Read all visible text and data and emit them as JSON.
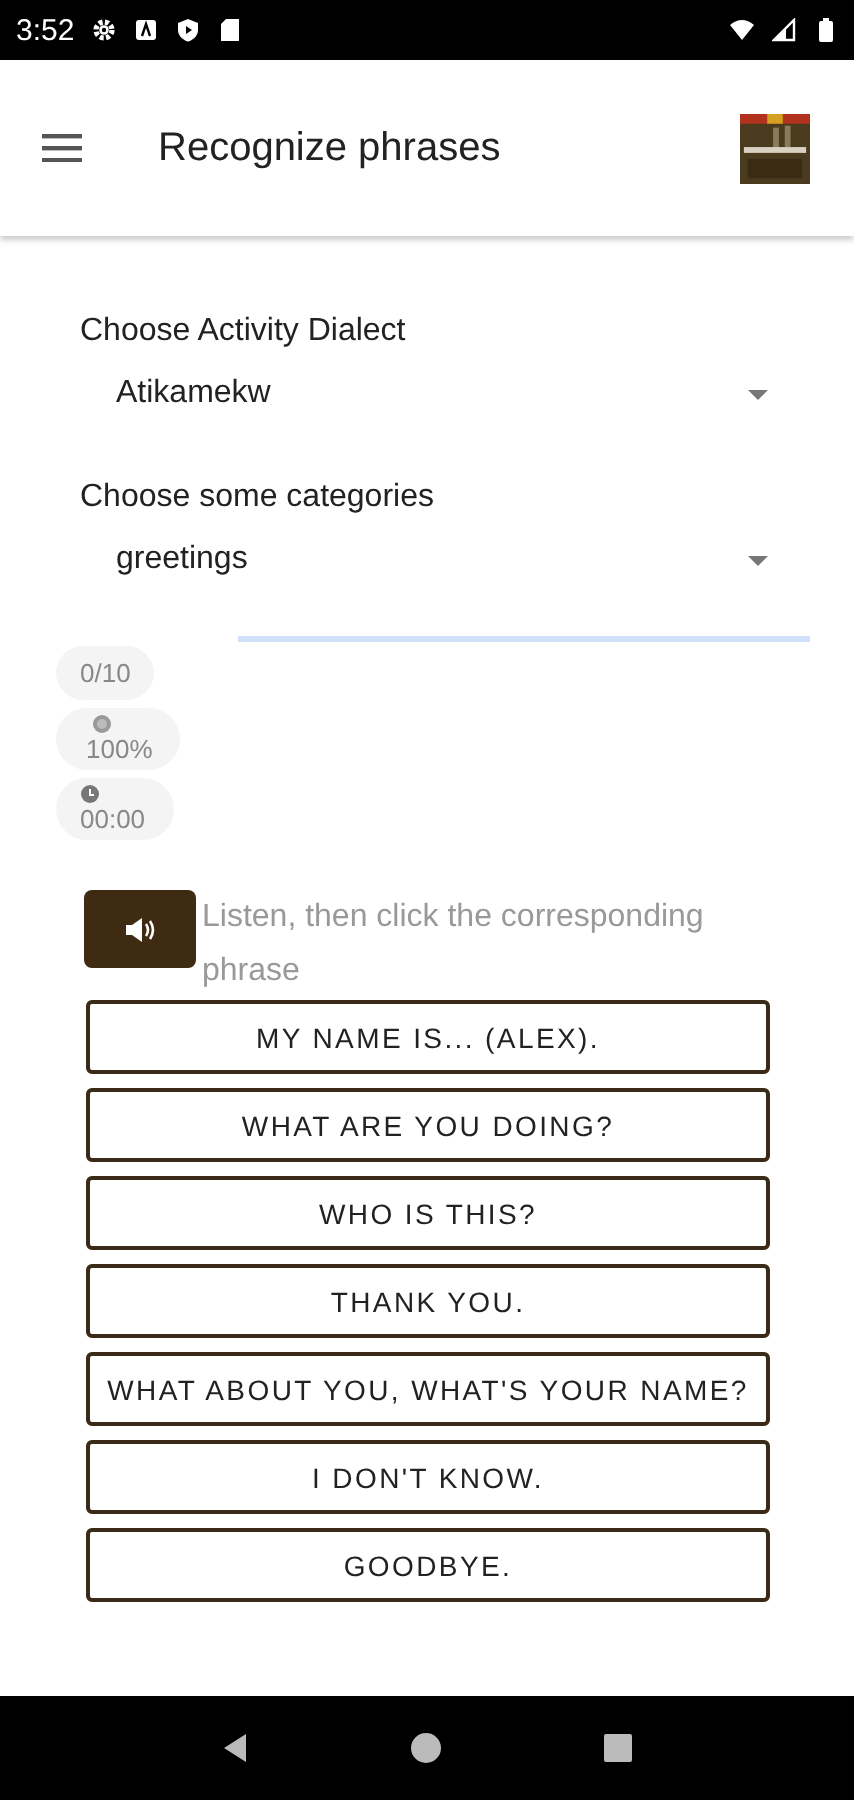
{
  "status_bar": {
    "time": "3:52"
  },
  "app_bar": {
    "title": "Recognize phrases"
  },
  "dialect": {
    "label": "Choose Activity Dialect",
    "value": "Atikamekw"
  },
  "categories": {
    "label": "Choose some categories",
    "value": "greetings"
  },
  "stats": [
    {
      "kind": "count",
      "text": "0/10"
    },
    {
      "kind": "accuracy",
      "text": "100%"
    },
    {
      "kind": "timer",
      "text": "00:00"
    }
  ],
  "instruction": "Listen, then click the corresponding phrase",
  "phrases": [
    "MY NAME IS... (ALEX).",
    "WHAT ARE YOU DOING?",
    "WHO IS THIS?",
    "THANK YOU.",
    "WHAT ABOUT YOU, WHAT'S YOUR NAME?",
    "I DON'T KNOW.",
    "GOODBYE."
  ]
}
